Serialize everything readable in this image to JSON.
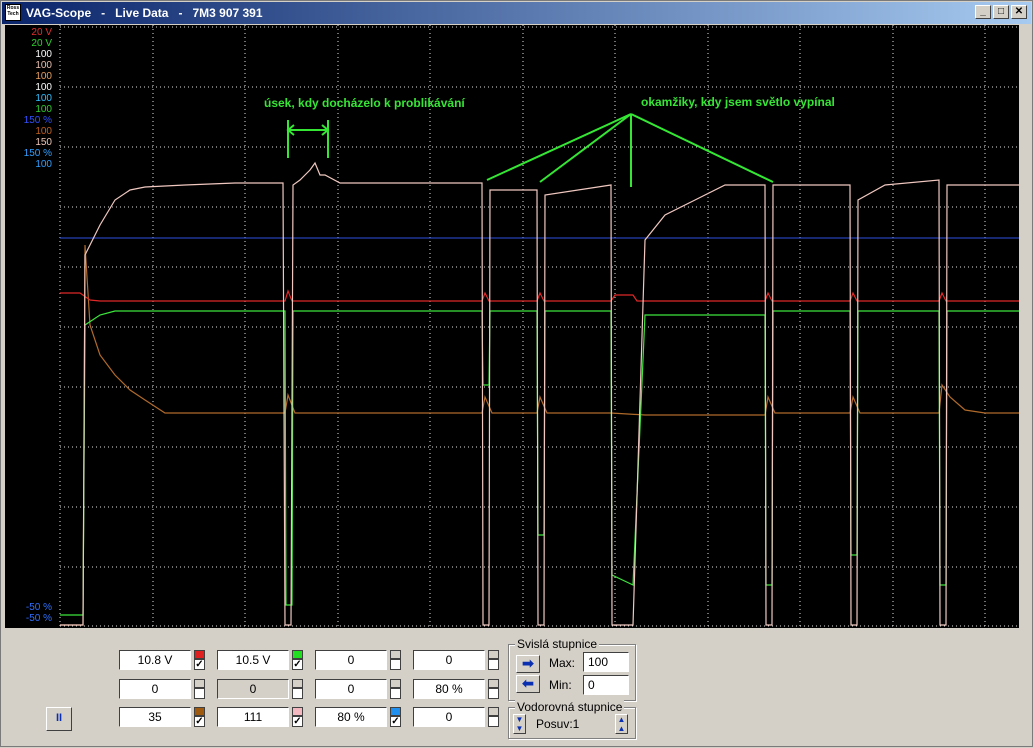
{
  "window": {
    "title": "VAG-Scope   -   Live Data   -   7M3 907 391",
    "icon_text": "Ross Tech",
    "min_label": "_",
    "max_label": "□",
    "close_label": "✕"
  },
  "scale_labels": [
    {
      "text": "20 V",
      "color": "#e03030"
    },
    {
      "text": "20 V",
      "color": "#30d030"
    },
    {
      "text": "100",
      "color": "#ffffff"
    },
    {
      "text": "100",
      "color": "#e8c0b0"
    },
    {
      "text": "100",
      "color": "#e8a060"
    },
    {
      "text": "100",
      "color": "#ffffff"
    },
    {
      "text": "100",
      "color": "#30c0ff"
    },
    {
      "text": "100",
      "color": "#30d030"
    },
    {
      "text": "150 %",
      "color": "#3050ff"
    },
    {
      "text": "100",
      "color": "#c06020"
    },
    {
      "text": "150",
      "color": "#f0c8b8"
    },
    {
      "text": "150 %",
      "color": "#30a0ff"
    },
    {
      "text": "100",
      "color": "#30a0ff"
    }
  ],
  "scale_labels_bottom": [
    {
      "text": "-50 %",
      "color": "#3070ff"
    },
    {
      "text": "-50 %",
      "color": "#3070ff"
    }
  ],
  "annotations": {
    "flicker_text": "úsek, kdy docházelo k problikávání",
    "switch_off_text": "okamžiky, kdy jsem světlo vypínal"
  },
  "channels": [
    {
      "value": "10.8 V",
      "swatch": "#e02020",
      "checked": true
    },
    {
      "value": "10.5 V",
      "swatch": "#20e020",
      "checked": true
    },
    {
      "value": "0",
      "swatch": "",
      "checked": false
    },
    {
      "value": "0",
      "swatch": "",
      "checked": false
    },
    {
      "value": "0",
      "swatch": "",
      "checked": false
    },
    {
      "value": "0",
      "swatch": "",
      "checked": false,
      "selected": true
    },
    {
      "value": "0",
      "swatch": "",
      "checked": false
    },
    {
      "value": "80 %",
      "swatch": "",
      "checked": false
    },
    {
      "value": "35",
      "swatch": "#a05a10",
      "checked": true
    },
    {
      "value": "111",
      "swatch": "#f4b8c0",
      "checked": true
    },
    {
      "value": "80 %",
      "swatch": "#2090f0",
      "checked": true
    },
    {
      "value": "0",
      "swatch": "",
      "checked": false
    }
  ],
  "vertical_scale": {
    "title": "Svislá stupnice",
    "max_label": "Max:",
    "max_value": "100",
    "min_label": "Min:",
    "min_value": "0"
  },
  "horizontal_scale": {
    "title": "Vodorovná stupnice",
    "offset_label": "Posuv:1"
  },
  "pause_label": "II",
  "colors": {
    "red": "#e02828",
    "green": "#3ce63c",
    "pink": "#f0c8c0",
    "brown": "#b06a2a",
    "blue": "#3050e0",
    "grid": "#e0e0e0"
  }
}
